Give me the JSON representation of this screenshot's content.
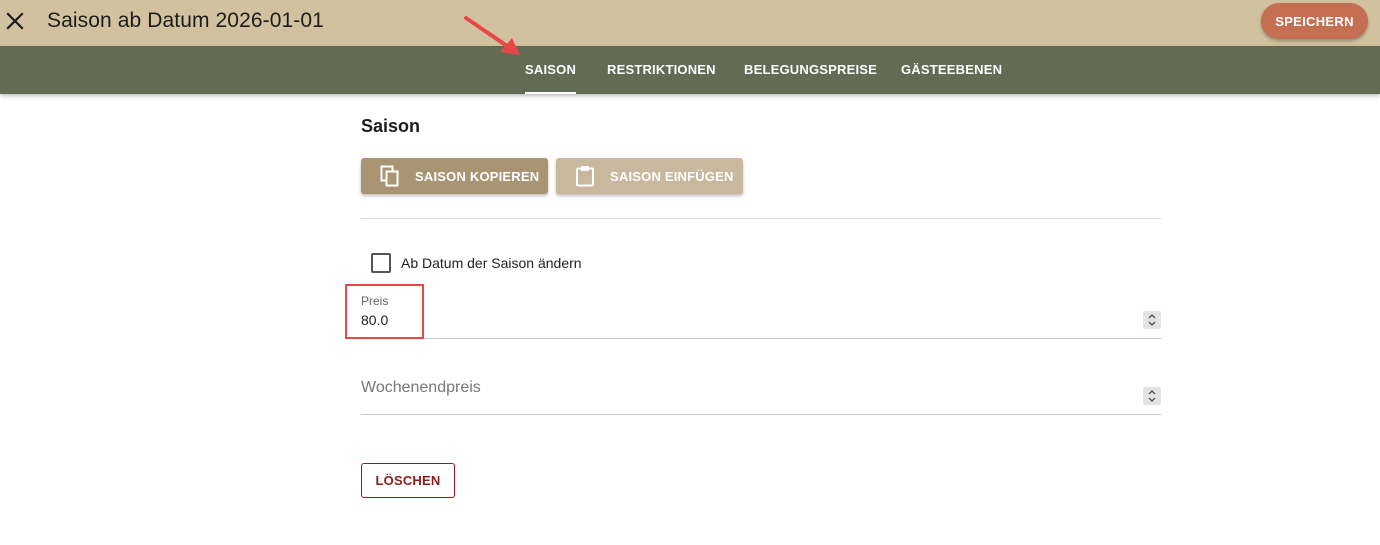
{
  "header": {
    "title": "Saison ab Datum 2026-01-01",
    "close_icon": "close-icon",
    "save_label": "SPEICHERN"
  },
  "tabs": [
    {
      "label": "SAISON",
      "active": true
    },
    {
      "label": "RESTRIKTIONEN",
      "active": false
    },
    {
      "label": "BELEGUNGSPREISE",
      "active": false
    },
    {
      "label": "GÄSTEEBENEN",
      "active": false
    }
  ],
  "main": {
    "section_title": "Saison",
    "copy_button": {
      "label": "SAISON KOPIEREN",
      "icon": "copy-icon"
    },
    "paste_button": {
      "label": "SAISON EINFÜGEN",
      "icon": "clipboard-icon"
    },
    "change_date_checkbox": {
      "label": "Ab Datum der Saison ändern",
      "checked": false
    },
    "price_field": {
      "label": "Preis",
      "value": "80.0"
    },
    "weekend_price_field": {
      "placeholder": "Wochenendpreis",
      "value": ""
    },
    "delete_label": "LÖSCHEN"
  },
  "colors": {
    "header_bg": "#d2c19e",
    "tabbar_bg": "#646b55",
    "save_button": "#c46f52",
    "copy_button": "#a99474",
    "paste_button": "#c8b89e",
    "delete_text": "#8a1c1c",
    "annotation": "#e8474a"
  }
}
